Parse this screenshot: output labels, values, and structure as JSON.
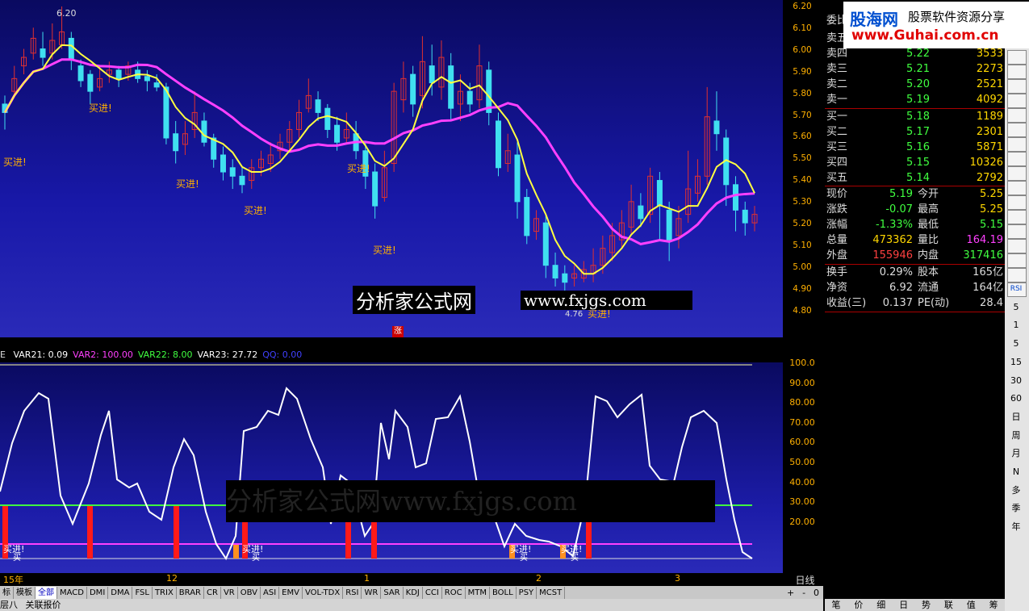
{
  "logo": {
    "title": "股海网",
    "subtitle": "股票软件资源分享",
    "url": "www.Guhai.com.cn"
  },
  "main_chart": {
    "price_ticks": [
      "6.20",
      "6.10",
      "6.00",
      "5.90",
      "5.80",
      "5.70",
      "5.60",
      "5.50",
      "5.40",
      "5.30",
      "5.20",
      "5.10",
      "5.00",
      "4.90",
      "4.80"
    ],
    "high_mark": "6.20",
    "low_mark": "4.76",
    "buy_label": "买进!",
    "watermark": "分析家公式网",
    "watermark2": "www.fxjgs.com",
    "zhang_label": "涨",
    "colors": {
      "up": "#e03030",
      "down": "#40e0f0",
      "ma_fast": "#ffff40",
      "ma_slow": "#ff40ff",
      "fill": "#8a2a20"
    }
  },
  "indicator": {
    "legend": [
      {
        "text": "VAR21: 0.09",
        "color": "#ffffff"
      },
      {
        "text": "VAR2: 100.00",
        "color": "#ff40ff"
      },
      {
        "text": "VAR22: 8.00",
        "color": "#40ff40"
      },
      {
        "text": "VAR23: 27.72",
        "color": "#ffffff"
      },
      {
        "text": "QQ: 0.00",
        "color": "#4040ff"
      }
    ],
    "prefix": "E",
    "ticks": [
      "100.0",
      "90.00",
      "80.00",
      "70.00",
      "60.00",
      "50.00",
      "40.00",
      "30.00",
      "20.00"
    ],
    "buy_label": "买进!",
    "sell_short": "买",
    "watermark": "分析家公式网www.fxjgs.com"
  },
  "date_axis": {
    "labels": [
      "15年",
      "12",
      "1",
      "2",
      "3"
    ],
    "period": "日线"
  },
  "tabs": [
    "标",
    "模板",
    "全部",
    "MACD",
    "DMI",
    "DMA",
    "FSL",
    "TRIX",
    "BRAR",
    "CR",
    "VR",
    "OBV",
    "ASI",
    "EMV",
    "VOL-TDX",
    "RSI",
    "WR",
    "SAR",
    "KDJ",
    "CCI",
    "ROC",
    "MTM",
    "BOLL",
    "PSY",
    "MCST"
  ],
  "active_tab": "全部",
  "bottom_left": [
    "层八",
    "关联报价"
  ],
  "zoom": [
    "+",
    "-",
    "0"
  ],
  "quote": {
    "committee": "委比",
    "sells": [
      {
        "label": "卖五",
        "price": "",
        "vol": ""
      },
      {
        "label": "卖四",
        "price": "5.22",
        "vol": "3533"
      },
      {
        "label": "卖三",
        "price": "5.21",
        "vol": "2273"
      },
      {
        "label": "卖二",
        "price": "5.20",
        "vol": "2521"
      },
      {
        "label": "卖一",
        "price": "5.19",
        "vol": "4092"
      }
    ],
    "buys": [
      {
        "label": "买一",
        "price": "5.18",
        "vol": "1189"
      },
      {
        "label": "买二",
        "price": "5.17",
        "vol": "2301"
      },
      {
        "label": "买三",
        "price": "5.16",
        "vol": "5871"
      },
      {
        "label": "买四",
        "price": "5.15",
        "vol": "10326"
      },
      {
        "label": "买五",
        "price": "5.14",
        "vol": "2792"
      }
    ],
    "stats": [
      {
        "l1": "现价",
        "v1": "5.19",
        "c1": "#40ff40",
        "l2": "今开",
        "v2": "5.25",
        "c2": "#ffd700"
      },
      {
        "l1": "涨跌",
        "v1": "-0.07",
        "c1": "#40ff40",
        "l2": "最高",
        "v2": "5.25",
        "c2": "#ffd700"
      },
      {
        "l1": "涨幅",
        "v1": "-1.33%",
        "c1": "#40ff40",
        "l2": "最低",
        "v2": "5.15",
        "c2": "#40ff40"
      },
      {
        "l1": "总量",
        "v1": "473362",
        "c1": "#ffd700",
        "l2": "量比",
        "v2": "164.19",
        "c2": "#ff40ff"
      },
      {
        "l1": "外盘",
        "v1": "155946",
        "c1": "#ff4040",
        "l2": "内盘",
        "v2": "317416",
        "c2": "#40ff40"
      }
    ],
    "stats2": [
      {
        "l1": "换手",
        "v1": "0.29%",
        "l2": "股本",
        "v2": "165亿"
      },
      {
        "l1": "净资",
        "v1": "6.92",
        "l2": "流通",
        "v2": "164亿"
      },
      {
        "l1": "收益(三)",
        "v1": "0.137",
        "l2": "PE(动)",
        "v2": "28.4"
      }
    ]
  },
  "side_toolbar": [
    "RSI",
    "5",
    "1",
    "5",
    "15",
    "30",
    "60",
    "日",
    "周",
    "月",
    "N",
    "多",
    "季",
    "年"
  ],
  "bottom_right": [
    "笔",
    "价",
    "细",
    "日",
    "势",
    "联",
    "值",
    "筹"
  ]
}
